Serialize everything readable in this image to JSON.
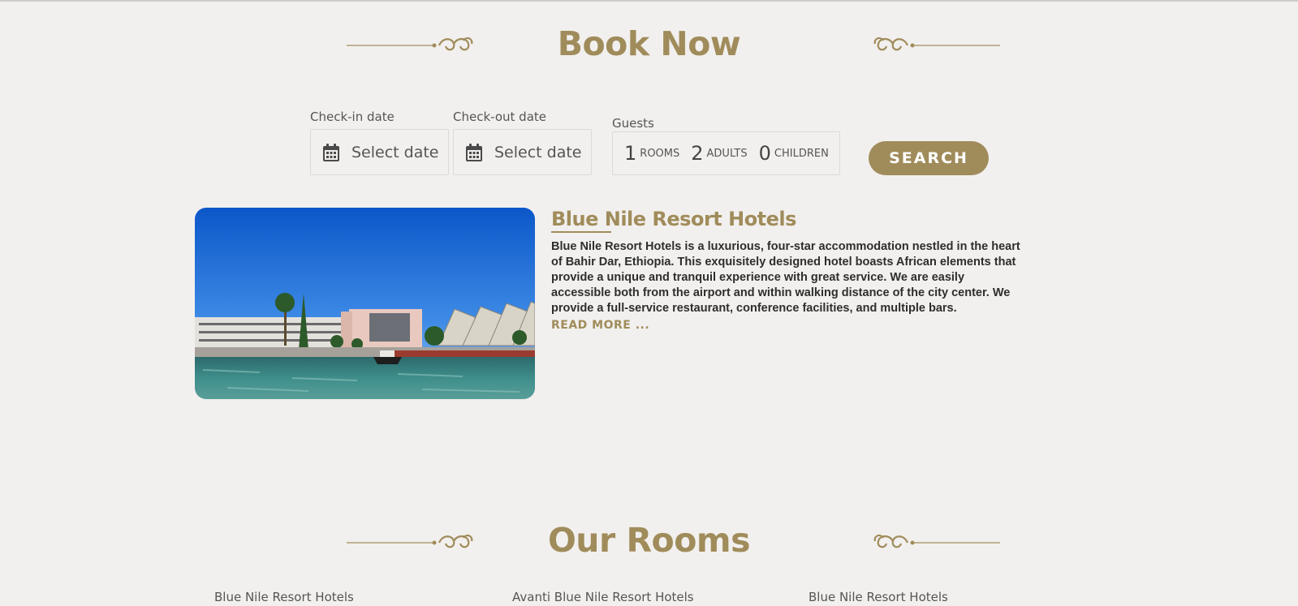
{
  "book_section": {
    "title": "Book Now",
    "checkin": {
      "label": "Check-in date",
      "placeholder": "Select date"
    },
    "checkout": {
      "label": "Check-out date",
      "placeholder": "Select date"
    },
    "guests": {
      "label": "Guests",
      "rooms_value": "1",
      "rooms_label": "ROOMS",
      "adults_value": "2",
      "adults_label": "ADULTS",
      "children_value": "0",
      "children_label": "CHILDREN"
    },
    "search_label": "SEARCH"
  },
  "hotel": {
    "name": "Blue Nile Resort Hotels",
    "description": "Blue Nile Resort Hotels is a luxurious, four-star accommodation nestled in the heart of Bahir Dar, Ethiopia. This exquisitely designed hotel boasts African elements that provide a unique and tranquil experience with great service. We are easily accessible both from the airport and within walking distance of the city center. We provide a full-service restaurant, conference facilities, and multiple bars.",
    "read_more": "READ MORE ..."
  },
  "rooms_section": {
    "title": "Our Rooms",
    "tabs": [
      "Blue Nile Resort Hotels",
      "Avanti Blue Nile Resort Hotels",
      "Blue Nile Resort Hotels"
    ]
  },
  "colors": {
    "accent": "#a08c5b",
    "background": "#f2f0ee",
    "text": "#2e2e2e"
  },
  "icons": [
    "calendar-icon",
    "flourish-left-icon",
    "flourish-right-icon"
  ]
}
